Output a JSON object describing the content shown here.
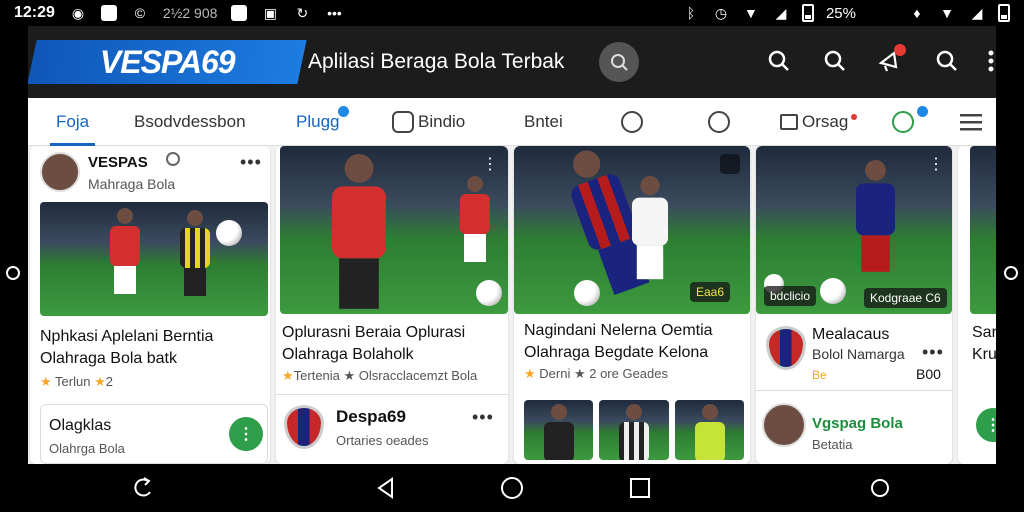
{
  "status": {
    "time": "12:29",
    "left_text": "2½2 908",
    "battery": "25%",
    "icons_left": [
      "eye-icon",
      "app-icon",
      "copyright-icon",
      "app-square-icon",
      "image-icon",
      "sync-icon",
      "dots-icon"
    ],
    "icons_right": [
      "bluetooth-icon",
      "alarm-icon",
      "wifi-icon",
      "signal-icon",
      "battery-icon"
    ]
  },
  "header": {
    "logo": "VESPA69",
    "title": "Aplilasi Beraga Bola Terbak"
  },
  "tabs": [
    {
      "label": "Foja"
    },
    {
      "label": "Bsodvdessbon"
    },
    {
      "label": "Plugg"
    },
    {
      "label": "Bindio"
    },
    {
      "label": "Bntei"
    },
    {
      "label": ""
    },
    {
      "label": ""
    },
    {
      "label": "Orsag"
    },
    {
      "label": ""
    }
  ],
  "cards": {
    "c1": {
      "account": "VESPAS",
      "subtitle": "Mahraga Bola",
      "title": "Nphkasi Aplelani Berntia Olahraga Bola batk",
      "meta": "Terlun",
      "rating": "2",
      "sub_title": "Olagklas",
      "sub_meta": "Olahrga Bola"
    },
    "c2": {
      "title": "Oplurasni Beraia Oplurasi Olahraga Bolaholk",
      "meta": "Tertenia ★ Olsracclacemzt Bola",
      "app_name": "Despa69",
      "app_meta": "Ortaries oeades"
    },
    "c3": {
      "badge": "Eaa6",
      "title": "Nagindani Nelerna Oemtia Olahraga Begdate Kelona",
      "meta": "Derni ★ 2 ore Geades"
    },
    "c4": {
      "chip_left": "bdclicio",
      "chip_right": "Kodgraae C6",
      "title": "Mealacaus",
      "subtitle": "Bolol Namarga",
      "meta_left": "Be",
      "meta_right": "B00",
      "user": "Vgspag Bola",
      "user_meta": "Betatia"
    },
    "c5": {
      "title": "Sar Kru"
    }
  }
}
